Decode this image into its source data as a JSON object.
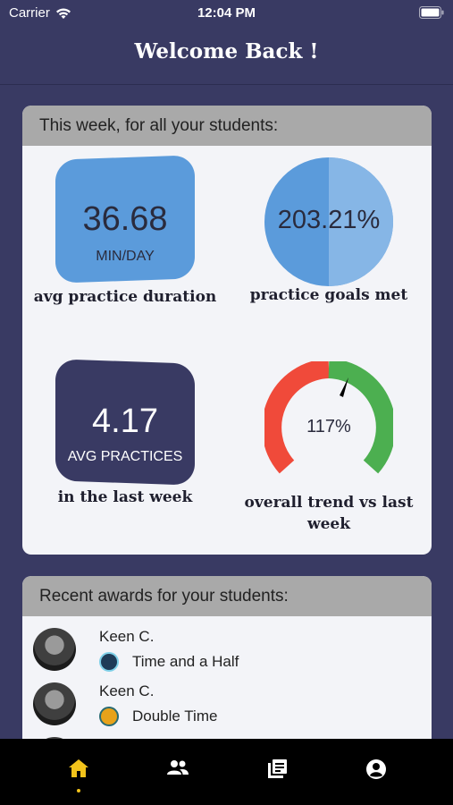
{
  "status_bar": {
    "carrier": "Carrier",
    "time": "12:04 PM"
  },
  "header": {
    "title": "Welcome Back !"
  },
  "stats": {
    "section_title": "This week, for all your students:",
    "avg_duration": {
      "value": "36.68",
      "unit": "MIN/DAY",
      "label": "avg practice duration"
    },
    "goals_met": {
      "value": "203.21%",
      "label": "practice goals met",
      "fill_fraction": 1.0
    },
    "avg_practices": {
      "value": "4.17",
      "unit": "AVG PRACTICES",
      "label": "in the last week"
    },
    "trend": {
      "value": "117%",
      "label_line1": "overall trend vs last",
      "label_line2": "week",
      "needle_percent": 117
    }
  },
  "awards": {
    "section_title": "Recent awards for your students:",
    "items": [
      {
        "student": "Keen C.",
        "award": "Time and a Half",
        "badge_color": "#1f3b57",
        "badge_icon": "clock-badge-icon"
      },
      {
        "student": "Keen C.",
        "award": "Double Time",
        "badge_color": "#e8a21a",
        "badge_icon": "smile-badge-icon"
      }
    ]
  },
  "colors": {
    "background": "#393a63",
    "tile_blue": "#5b9bdb",
    "pie_light": "#86b6e6",
    "gauge_red": "#f04a3a",
    "gauge_green": "#4caf50",
    "tab_active": "#f2c31b"
  },
  "tabs": [
    {
      "name": "home",
      "icon": "home-icon",
      "active": true
    },
    {
      "name": "students",
      "icon": "people-icon",
      "active": false
    },
    {
      "name": "library",
      "icon": "library-icon",
      "active": false
    },
    {
      "name": "profile",
      "icon": "account-icon",
      "active": false
    }
  ]
}
